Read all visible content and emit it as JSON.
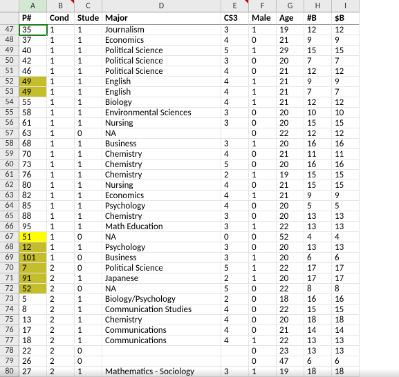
{
  "columns": [
    "",
    "A",
    "B",
    "C",
    "D",
    "E",
    "F",
    "G",
    "H",
    "I"
  ],
  "header_row": {
    "num": "",
    "cells": [
      "P#",
      "Cond",
      "Stude",
      "Major",
      "CS3",
      "Male",
      "Age",
      "#B",
      "$B"
    ]
  },
  "selected_col": "A",
  "comment_cols": [
    "B",
    "E"
  ],
  "rows": [
    {
      "num": 47,
      "cells": [
        "35",
        "1",
        "1",
        "Journalism",
        "3",
        "1",
        "19",
        "12",
        "12"
      ]
    },
    {
      "num": 48,
      "cells": [
        "37",
        "1",
        "1",
        "Economics",
        "4",
        "0",
        "21",
        "9",
        "9"
      ]
    },
    {
      "num": 49,
      "cells": [
        "40",
        "1",
        "1",
        "Political Science",
        "5",
        "1",
        "29",
        "15",
        "15"
      ]
    },
    {
      "num": 50,
      "cells": [
        "42",
        "1",
        "1",
        "Political Science",
        "3",
        "0",
        "20",
        "7",
        "7"
      ]
    },
    {
      "num": 51,
      "cells": [
        "46",
        "1",
        "1",
        "Political Science",
        "4",
        "0",
        "21",
        "12",
        "12"
      ]
    },
    {
      "num": 52,
      "cells": [
        "49",
        "1",
        "1",
        "English",
        "4",
        "1",
        "21",
        "9",
        "9"
      ],
      "hlA": "dark"
    },
    {
      "num": 53,
      "cells": [
        "49",
        "1",
        "1",
        "English",
        "4",
        "1",
        "21",
        "7",
        "7"
      ],
      "hlA": "dark"
    },
    {
      "num": 54,
      "cells": [
        "55",
        "1",
        "1",
        "Biology",
        "4",
        "1",
        "21",
        "12",
        "12"
      ]
    },
    {
      "num": 55,
      "cells": [
        "58",
        "1",
        "1",
        "Environmental Sciences",
        "3",
        "0",
        "20",
        "10",
        "10"
      ]
    },
    {
      "num": 56,
      "cells": [
        "61",
        "1",
        "1",
        "Nursing",
        "3",
        "0",
        "20",
        "15",
        "15"
      ]
    },
    {
      "num": 57,
      "cells": [
        "63",
        "1",
        "0",
        "NA",
        "",
        "0",
        "22",
        "12",
        "12"
      ]
    },
    {
      "num": 58,
      "cells": [
        "68",
        "1",
        "1",
        "Business",
        "3",
        "1",
        "20",
        "16",
        "16"
      ]
    },
    {
      "num": 59,
      "cells": [
        "70",
        "1",
        "1",
        "Chemistry",
        "4",
        "0",
        "21",
        "11",
        "11"
      ]
    },
    {
      "num": 60,
      "cells": [
        "73",
        "1",
        "1",
        "Chemistry",
        "5",
        "0",
        "20",
        "16",
        "16"
      ]
    },
    {
      "num": 61,
      "cells": [
        "76",
        "1",
        "1",
        "Chemistry",
        "2",
        "1",
        "19",
        "15",
        "15"
      ]
    },
    {
      "num": 62,
      "cells": [
        "80",
        "1",
        "1",
        "Nursing",
        "4",
        "0",
        "21",
        "15",
        "15"
      ]
    },
    {
      "num": 63,
      "cells": [
        "82",
        "1",
        "1",
        "Economics",
        "4",
        "1",
        "21",
        "9",
        "9"
      ]
    },
    {
      "num": 64,
      "cells": [
        "85",
        "1",
        "1",
        "Psychology",
        "4",
        "0",
        "20",
        "5",
        "5"
      ]
    },
    {
      "num": 65,
      "cells": [
        "88",
        "1",
        "1",
        "Chemistry",
        "3",
        "0",
        "20",
        "13",
        "13"
      ]
    },
    {
      "num": 66,
      "cells": [
        "95",
        "1",
        "1",
        "Math Education",
        "3",
        "1",
        "22",
        "13",
        "13"
      ]
    },
    {
      "num": 67,
      "cells": [
        "51",
        "1",
        "0",
        "NA",
        "0",
        "0",
        "52",
        "4",
        "4"
      ],
      "hlA": "yellow"
    },
    {
      "num": 68,
      "cells": [
        "12",
        "1",
        "1",
        "Psychology",
        "3",
        "0",
        "20",
        "13",
        "13"
      ],
      "hlA": "dark"
    },
    {
      "num": 69,
      "cells": [
        "101",
        "1",
        "0",
        "Business",
        "3",
        "1",
        "20",
        "6",
        "6"
      ],
      "hlA": "dark"
    },
    {
      "num": 70,
      "cells": [
        "7",
        "2",
        "0",
        "Political Science",
        "5",
        "1",
        "22",
        "17",
        "17"
      ],
      "hlA": "dark"
    },
    {
      "num": 71,
      "cells": [
        "91",
        "2",
        "1",
        "Japanese",
        "2",
        "1",
        "20",
        "17",
        "17"
      ],
      "hlA": "dark"
    },
    {
      "num": 72,
      "cells": [
        "52",
        "2",
        "0",
        "NA",
        "5",
        "0",
        "22",
        "8",
        "8"
      ],
      "hlA": "dark"
    },
    {
      "num": 73,
      "cells": [
        "5",
        "2",
        "1",
        "Biology/Psychology",
        "2",
        "0",
        "18",
        "16",
        "16"
      ]
    },
    {
      "num": 74,
      "cells": [
        "8",
        "2",
        "1",
        "Communication Studies",
        "4",
        "0",
        "22",
        "15",
        "15"
      ]
    },
    {
      "num": 75,
      "cells": [
        "13",
        "2",
        "1",
        "Chemistry",
        "4",
        "0",
        "20",
        "18",
        "18"
      ]
    },
    {
      "num": 76,
      "cells": [
        "17",
        "2",
        "1",
        "Communications",
        "4",
        "0",
        "21",
        "14",
        "14"
      ]
    },
    {
      "num": 77,
      "cells": [
        "18",
        "2",
        "1",
        "Communications",
        "4",
        "1",
        "22",
        "13",
        "13"
      ]
    },
    {
      "num": 78,
      "cells": [
        "22",
        "2",
        "0",
        "",
        "",
        "0",
        "23",
        "13",
        "13"
      ]
    },
    {
      "num": 79,
      "cells": [
        "26",
        "2",
        "0",
        "",
        "",
        "0",
        "47",
        "6",
        "6"
      ]
    },
    {
      "num": 80,
      "cells": [
        "27",
        "2",
        "1",
        "Mathematics - Sociology",
        "3",
        "1",
        "19",
        "18",
        "18"
      ]
    }
  ]
}
